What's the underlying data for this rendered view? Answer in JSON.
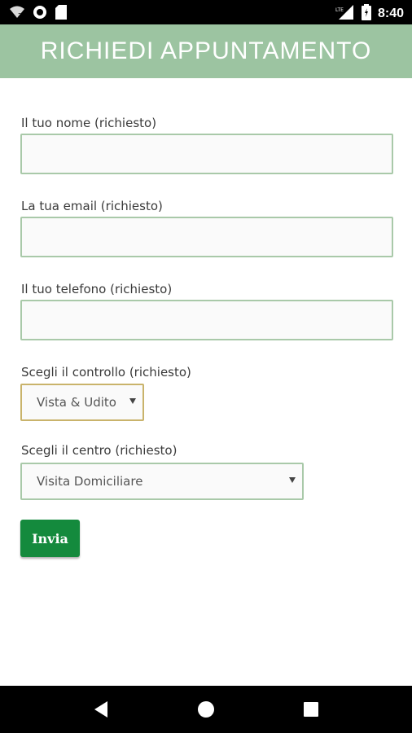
{
  "status_bar": {
    "time": "8:40",
    "network": "LTE",
    "icons": [
      "wifi-icon",
      "sync-icon",
      "sd-card-icon",
      "lte-signal-icon",
      "battery-icon"
    ]
  },
  "header": {
    "title": "RICHIEDI APPUNTAMENTO",
    "background_color": "#9cc4a1"
  },
  "form": {
    "name_label": "Il tuo nome (richiesto)",
    "name_value": "",
    "email_label": "La tua email (richiesto)",
    "email_value": "",
    "phone_label": "Il tuo telefono (richiesto)",
    "phone_value": "",
    "control_label": "Scegli il controllo (richiesto)",
    "control_selected": "Vista & Udito",
    "center_label": "Scegli il centro (richiesto)",
    "center_selected": "Visita Domiciliare",
    "submit_label": "Invia",
    "submit_color": "#148a3d"
  },
  "nav_bar": {
    "icons": [
      "back-icon",
      "home-icon",
      "recents-icon"
    ]
  }
}
